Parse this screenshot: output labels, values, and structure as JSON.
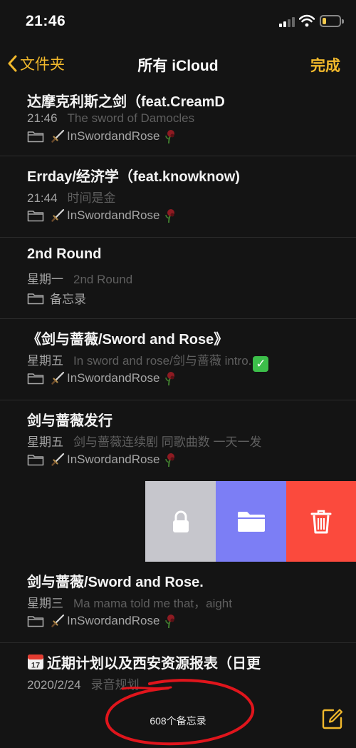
{
  "status_bar": {
    "time": "21:46"
  },
  "nav": {
    "back_label": "文件夹",
    "title": "所有 iCloud",
    "done_label": "完成"
  },
  "notes": [
    {
      "title": "达摩克利斯之剑（feat.CreamD",
      "time": "21:46",
      "preview": "The sword of Damocles",
      "folder": "InSwordandRose",
      "folder_icons": true
    },
    {
      "title": "Errday/经济学（feat.knowknow)",
      "time": "21:44",
      "preview": "时间是金",
      "folder": "InSwordandRose",
      "folder_icons": true
    },
    {
      "title": "2nd Round",
      "time": "星期一",
      "preview": "2nd Round",
      "folder": "备忘录",
      "folder_icons": false
    },
    {
      "title": "《剑与蔷薇/Sword and Rose》",
      "time": "星期五",
      "preview": "In sword and rose/剑与蔷薇 intro.",
      "folder": "InSwordandRose",
      "folder_icons": true
    },
    {
      "title": "剑与蔷薇发行",
      "time": "星期五",
      "preview": "剑与蔷薇连续剧 同歌曲数 一天一发",
      "folder": "InSwordandRose",
      "folder_icons": true
    }
  ],
  "swipe_actions": {
    "lock_icon": "lock-icon",
    "move_icon": "folder-icon",
    "delete_icon": "trash-icon",
    "lock_color": "#c6c6cc",
    "move_color": "#7c7ef5",
    "delete_color": "#fb4a3d"
  },
  "notes_lower": [
    {
      "title": "剑与蔷薇/Sword and Rose.",
      "time": "星期三",
      "preview": "Ma mama told me that，aight",
      "folder": "InSwordandRose",
      "folder_icons": true
    },
    {
      "title": "近期计划以及西安资源报表（日更",
      "time": "2020/2/24",
      "preview": "录音规划"
    }
  ],
  "footer": {
    "count_label": "608个备忘录"
  },
  "colors": {
    "accent": "#f2b92c",
    "background": "#141414",
    "annotation": "#e0151c"
  }
}
